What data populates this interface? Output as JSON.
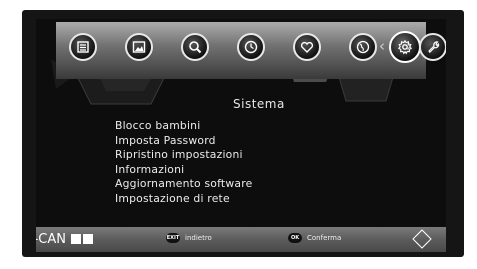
{
  "brand": {
    "name": "i-CAN"
  },
  "iconbar": {
    "items": [
      {
        "name": "program-guide-icon"
      },
      {
        "name": "media-icon"
      },
      {
        "name": "search-icon"
      },
      {
        "name": "timer-icon"
      },
      {
        "name": "favorite-icon"
      },
      {
        "name": "globe-icon"
      },
      {
        "name": "settings-icon",
        "selected": true
      },
      {
        "name": "tools-icon"
      }
    ],
    "left_arrow": "‹",
    "right_arrow": "›"
  },
  "menu": {
    "title": "Sistema",
    "items": [
      "Blocco bambini",
      "Imposta Password",
      "Ripristino impostazioni",
      "Informazioni",
      "Aggiornamento software",
      "Impostazione di rete"
    ]
  },
  "footer": {
    "exit_key": "EXIT",
    "exit_label": "indietro",
    "ok_key": "OK",
    "ok_label": "Conferma"
  },
  "colors": {
    "background": "#0d0d0d",
    "bar": "#6e6e6e",
    "text": "#ececec"
  }
}
